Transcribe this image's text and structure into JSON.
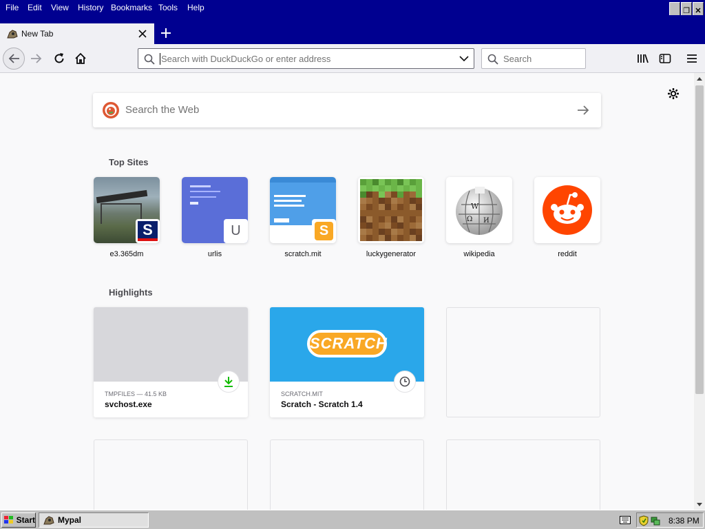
{
  "menu": [
    "File",
    "Edit",
    "View",
    "History",
    "Bookmarks",
    "Tools",
    "Help"
  ],
  "tab": {
    "title": "New Tab"
  },
  "urlbar": {
    "placeholder": "Search with DuckDuckGo or enter address"
  },
  "searchbar": {
    "placeholder": "Search"
  },
  "websearch": {
    "placeholder": "Search the Web"
  },
  "top_sites": {
    "heading": "Top Sites",
    "sites": [
      {
        "label": "e3.365dm",
        "badge": "S"
      },
      {
        "label": "urlis",
        "badge": "U"
      },
      {
        "label": "scratch.mit",
        "badge": "S"
      },
      {
        "label": "luckygenerator"
      },
      {
        "label": "wikipedia"
      },
      {
        "label": "reddit"
      }
    ]
  },
  "highlights": {
    "heading": "Highlights",
    "cards": [
      {
        "source": "TMPFILES — 41.5 KB",
        "title": "svchost.exe",
        "icon": "download-icon"
      },
      {
        "source": "SCRATCH.MIT",
        "title": "Scratch - Scratch 1.4",
        "icon": "clock-icon",
        "logo": "SCRATCH"
      }
    ]
  },
  "taskbar": {
    "start": "Start",
    "task": "Mypal",
    "time": "8:38 PM"
  },
  "colors": {
    "titlebar": "#000090",
    "reddit": "#ff4500",
    "scratch": "#2aa7ea"
  }
}
